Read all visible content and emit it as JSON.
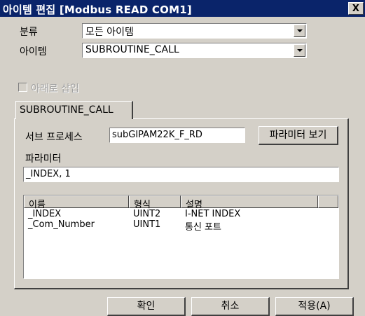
{
  "window": {
    "title": "아이템 편집 [Modbus READ COM1]",
    "close_label": "X"
  },
  "category": {
    "label": "분류",
    "value": "모든 아이템"
  },
  "item": {
    "label": "아이템",
    "value": "SUBROUTINE_CALL"
  },
  "insert_below": {
    "label": "아래로 삽입",
    "checked": false
  },
  "tab": {
    "label": "SUBROUTINE_CALL"
  },
  "subprocess": {
    "label": "서브 프로세스",
    "value": "subGIPAM22K_F_RD",
    "view_params_button": "파라미터 보기"
  },
  "parameters": {
    "label": "파라미터",
    "value": "_INDEX, 1"
  },
  "param_list": {
    "columns": [
      "이름",
      "형식",
      "설명"
    ],
    "rows": [
      {
        "name": "_INDEX",
        "type": "UINT2",
        "desc": "I-NET INDEX"
      },
      {
        "name": "_Com_Number",
        "type": "UINT1",
        "desc": "통신 포트"
      }
    ]
  },
  "buttons": {
    "ok": "확인",
    "cancel": "취소",
    "apply": "적용(A)"
  }
}
